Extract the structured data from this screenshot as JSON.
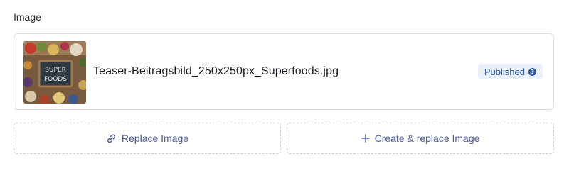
{
  "field": {
    "label": "Image"
  },
  "asset": {
    "file_name": "Teaser-Beitragsbild_250x250px_Superfoods.jpg",
    "status": "Published",
    "thumbnail_text_line1": "SUPER",
    "thumbnail_text_line2": "FOODS"
  },
  "actions": {
    "replace_label": "Replace Image",
    "create_label": "Create & replace Image"
  },
  "colors": {
    "accent": "#4d5a9c",
    "badge_bg": "#e9f0fb",
    "badge_text": "#2e5aa8"
  },
  "icons": {
    "replace": "link-icon",
    "create": "plus-icon",
    "status_help": "question-icon"
  }
}
